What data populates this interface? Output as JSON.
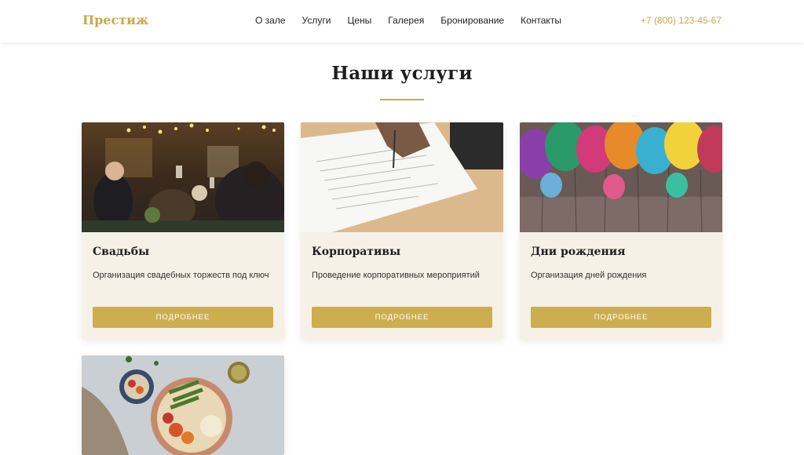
{
  "header": {
    "logo": "Престиж",
    "nav": [
      "О зале",
      "Услуги",
      "Цены",
      "Галерея",
      "Бронирование",
      "Контакты"
    ],
    "phone": "+7 (800) 123-45-67"
  },
  "services": {
    "title": "Наши услуги",
    "cards": [
      {
        "title": "Свадьбы",
        "description": "Организация свадебных торжеств под ключ",
        "button": "ПОДРОБНЕЕ",
        "image": "wedding-photo"
      },
      {
        "title": "Корпоративы",
        "description": "Проведение корпоративных мероприятий",
        "button": "ПОДРОБНЕЕ",
        "image": "signing-document-photo"
      },
      {
        "title": "Дни рождения",
        "description": "Организация дней рождения",
        "button": "ПОДРОБНЕЕ",
        "image": "balloons-photo"
      },
      {
        "image": "food-bowl-photo"
      }
    ]
  },
  "colors": {
    "accent": "#c9a84a",
    "card_bg": "#f6f1e6",
    "button": "#cdae4f"
  }
}
